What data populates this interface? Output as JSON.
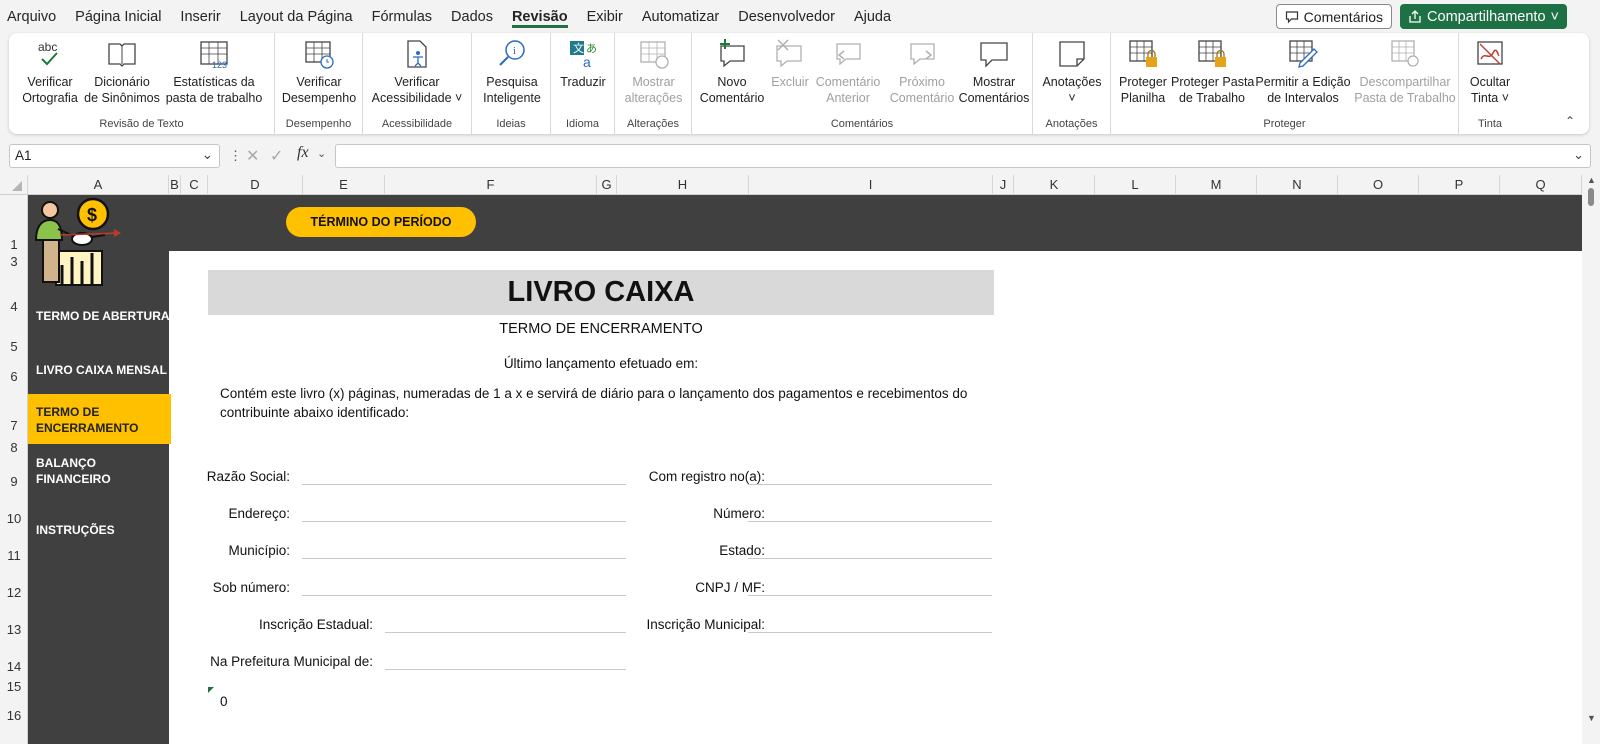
{
  "menu": [
    "Arquivo",
    "Página Inicial",
    "Inserir",
    "Layout da Página",
    "Fórmulas",
    "Dados",
    "Revisão",
    "Exibir",
    "Automatizar",
    "Desenvolvedor",
    "Ajuda"
  ],
  "topright": {
    "comments": "Comentários",
    "share": "Compartilhamento"
  },
  "ribbon": {
    "groups": {
      "revisao_texto": "Revisão de Texto",
      "desempenho": "Desempenho",
      "acessibilidade": "Acessibilidade",
      "ideias": "Ideias",
      "idioma": "Idioma",
      "alteracoes": "Alterações",
      "comentarios": "Comentários",
      "anotacoes": "Anotações",
      "proteger": "Proteger",
      "tinta": "Tinta"
    },
    "buttons": {
      "verificar_ortografia": "Verificar\nOrtografia",
      "dicionario": "Dicionário\nde Sinônimos",
      "estatisticas": "Estatísticas da\npasta de trabalho",
      "verificar_desempenho": "Verificar\nDesempenho",
      "verificar_acessibilidade": "Verificar\nAcessibilidade ˅",
      "pesquisa": "Pesquisa\nInteligente",
      "traduzir": "Traduzir",
      "mostrar_alteracoes": "Mostrar\nalterações",
      "novo_comentario": "Novo\nComentário",
      "excluir": "Excluir",
      "comentario_anterior": "Comentário\nAnterior",
      "proximo_comentario": "Próximo\nComentário",
      "mostrar_comentarios": "Mostrar\nComentários",
      "anotacoes": "Anotações\n˅",
      "proteger_planilha": "Proteger\nPlanilha",
      "proteger_pasta": "Proteger Pasta\nde Trabalho",
      "permitir_edicao": "Permitir a Edição\nde Intervalos",
      "descompartilhar": "Descompartilhar\nPasta de Trabalho",
      "ocultar_tinta": "Ocultar\nTinta ˅"
    }
  },
  "namebox": "A1",
  "columns": [
    "A",
    "B",
    "C",
    "D",
    "E",
    "F",
    "G",
    "H",
    "I",
    "J",
    "K",
    "L",
    "M",
    "N",
    "O",
    "P",
    "Q"
  ],
  "rows": [
    "1",
    "3",
    "4",
    "5",
    "6",
    "7",
    "8",
    "9",
    "10",
    "11",
    "12",
    "13",
    "14",
    "15",
    "16"
  ],
  "sheet": {
    "periodo": "TÉRMINO DO PERÍODO",
    "nav": [
      "TERMO DE ABERTURA",
      "LIVRO CAIXA MENSAL",
      "TERMO DE ENCERRAMENTO",
      "BALANÇO FINANCEIRO",
      "INSTRUÇÕES"
    ],
    "title": "LIVRO CAIXA",
    "subtitle": "TERMO DE ENCERRAMENTO",
    "ultimo": "Último lançamento efetuado em:",
    "paragrafo1": "Contém este livro (x) páginas, numeradas de 1 a x e servirá de diário para o lançamento dos pagamentos e recebimentos do",
    "paragrafo2": "contribuinte abaixo identificado:",
    "fields_left": [
      "Razão Social:",
      "Endereço:",
      "Município:",
      "Sob número:",
      "Inscrição Estadual:",
      "Na Prefeitura Municipal de:"
    ],
    "fields_right": [
      "Com registro no(a):",
      "Número:",
      "Estado:",
      "CNPJ / MF:",
      "Inscrição Municipal:"
    ],
    "zero": "0"
  }
}
